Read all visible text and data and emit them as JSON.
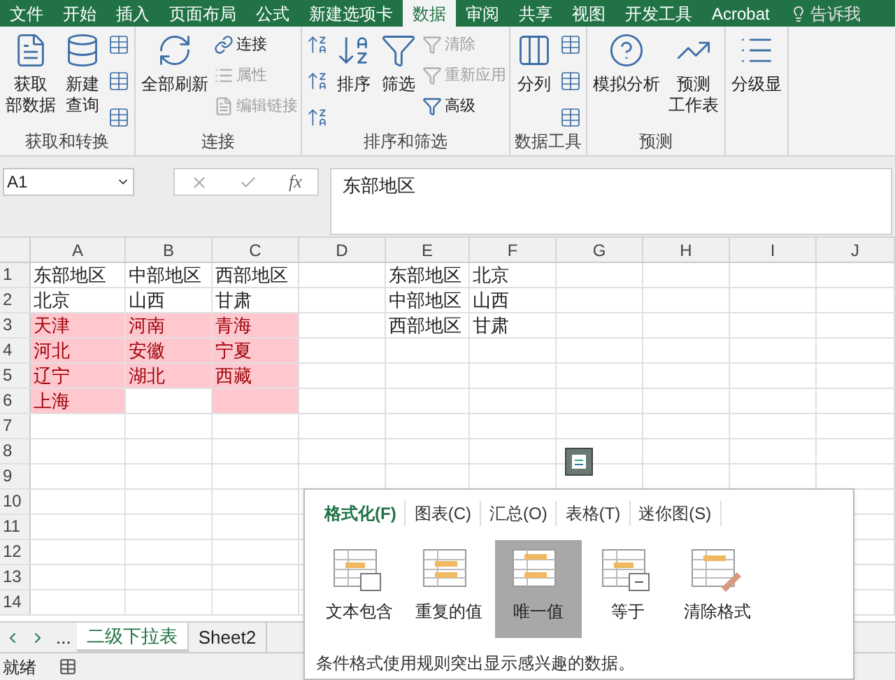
{
  "menu_tabs": [
    {
      "label": "文件",
      "selected": false
    },
    {
      "label": "开始",
      "selected": false
    },
    {
      "label": "插入",
      "selected": false
    },
    {
      "label": "页面布局",
      "selected": false
    },
    {
      "label": "公式",
      "selected": false
    },
    {
      "label": "新建选项卡",
      "selected": false
    },
    {
      "label": "数据",
      "selected": true
    },
    {
      "label": "审阅",
      "selected": false
    },
    {
      "label": "共享",
      "selected": false
    },
    {
      "label": "视图",
      "selected": false
    },
    {
      "label": "开发工具",
      "selected": false
    },
    {
      "label": "Acrobat",
      "selected": false
    }
  ],
  "tell_me": "告诉我",
  "ribbon": {
    "groups": [
      {
        "label": "获取和转换",
        "buttons": [
          {
            "kind": "large",
            "lines": [
              "获取",
              "部数据"
            ],
            "disabled": false
          },
          {
            "kind": "large",
            "lines": [
              "新建",
              "查询"
            ],
            "disabled": false
          },
          {
            "kind": "icons",
            "disabled": false
          }
        ]
      },
      {
        "label": "连接",
        "buttons": [
          {
            "kind": "large",
            "lines": [
              "全部刷新"
            ],
            "disabled": false
          },
          {
            "kind": "small",
            "lines": [
              "连接"
            ],
            "disabled": false
          },
          {
            "kind": "small",
            "lines": [
              "属性"
            ],
            "disabled": true
          },
          {
            "kind": "small",
            "lines": [
              "编辑链接"
            ],
            "disabled": true
          }
        ]
      },
      {
        "label": "排序和筛选",
        "buttons": [
          {
            "kind": "icons",
            "disabled": false
          },
          {
            "kind": "large",
            "lines": [
              "排序"
            ],
            "disabled": false
          },
          {
            "kind": "large",
            "lines": [
              "筛选"
            ],
            "disabled": false
          },
          {
            "kind": "small",
            "lines": [
              "清除"
            ],
            "disabled": true
          },
          {
            "kind": "small",
            "lines": [
              "重新应用"
            ],
            "disabled": true
          },
          {
            "kind": "small",
            "lines": [
              "高级"
            ],
            "disabled": false
          }
        ]
      },
      {
        "label": "数据工具",
        "buttons": [
          {
            "kind": "large",
            "lines": [
              "分列"
            ],
            "disabled": false
          },
          {
            "kind": "icons",
            "disabled": false
          }
        ]
      },
      {
        "label": "预测",
        "buttons": [
          {
            "kind": "large",
            "lines": [
              "模拟分析"
            ],
            "disabled": false
          },
          {
            "kind": "large",
            "lines": [
              "预测",
              "工作表"
            ],
            "disabled": false
          }
        ]
      },
      {
        "buttons": [
          {
            "kind": "large",
            "lines": [
              "分级显"
            ],
            "disabled": false
          }
        ]
      }
    ]
  },
  "name_box": "A1",
  "function_label": "fx",
  "formula": "东部地区",
  "columns": [
    "A",
    "B",
    "C",
    "D",
    "E",
    "F",
    "G",
    "H",
    "I",
    "J"
  ],
  "rows": [
    {
      "number": "1",
      "cells": [
        {
          "text": "东部地区",
          "highlighted": false
        },
        {
          "text": "中部地区",
          "highlighted": false
        },
        {
          "text": "西部地区",
          "highlighted": false
        },
        null,
        {
          "text": "东部地区",
          "highlighted": false
        },
        {
          "text": "北京",
          "highlighted": false
        }
      ]
    },
    {
      "number": "2",
      "cells": [
        {
          "text": "北京",
          "highlighted": false
        },
        {
          "text": "山西",
          "highlighted": false
        },
        {
          "text": "甘肃",
          "highlighted": false
        },
        null,
        {
          "text": "中部地区",
          "highlighted": false
        },
        {
          "text": "山西",
          "highlighted": false
        }
      ]
    },
    {
      "number": "3",
      "cells": [
        {
          "text": "天津",
          "highlighted": true
        },
        {
          "text": "河南",
          "highlighted": true
        },
        {
          "text": "青海",
          "highlighted": true
        },
        null,
        {
          "text": "西部地区",
          "highlighted": false
        },
        {
          "text": "甘肃",
          "highlighted": false
        }
      ]
    },
    {
      "number": "4",
      "cells": [
        {
          "text": "河北",
          "highlighted": true
        },
        {
          "text": "安徽",
          "highlighted": true
        },
        {
          "text": "宁夏",
          "highlighted": true
        }
      ]
    },
    {
      "number": "5",
      "cells": [
        {
          "text": "辽宁",
          "highlighted": true
        },
        {
          "text": "湖北",
          "highlighted": true
        },
        {
          "text": "西藏",
          "highlighted": true
        }
      ]
    },
    {
      "number": "6",
      "cells": [
        {
          "text": "上海",
          "highlighted": true
        },
        null,
        {
          "highlighted": true
        }
      ]
    },
    {
      "number": "7"
    },
    {
      "number": "8"
    },
    {
      "number": "9"
    },
    {
      "number": "10"
    },
    {
      "number": "11"
    },
    {
      "number": "12"
    },
    {
      "number": "13"
    },
    {
      "number": "14"
    }
  ],
  "sheet_tabs": [
    {
      "label": "二级下拉表",
      "selected": true
    },
    {
      "label": "Sheet2",
      "selected": false
    }
  ],
  "sheet_nav_more": "...",
  "status": "就绪",
  "quick_analysis": {
    "tabs": [
      {
        "label": "格式化(F)",
        "selected": true
      },
      {
        "label": "图表(C)",
        "selected": false
      },
      {
        "label": "汇总(O)",
        "selected": false
      },
      {
        "label": "表格(T)",
        "selected": false
      },
      {
        "label": "迷你图(S)",
        "selected": false
      }
    ],
    "options": [
      {
        "label": "文本包含",
        "kind": "text",
        "selected": false
      },
      {
        "label": "重复的值",
        "kind": "duplicate",
        "selected": false
      },
      {
        "label": "唯一值",
        "kind": "unique",
        "selected": true
      },
      {
        "label": "等于",
        "kind": "equal",
        "selected": false
      },
      {
        "label": "清除格式",
        "kind": "clear",
        "selected": false
      }
    ],
    "description": "条件格式使用规则突出显示感兴趣的数据。"
  }
}
